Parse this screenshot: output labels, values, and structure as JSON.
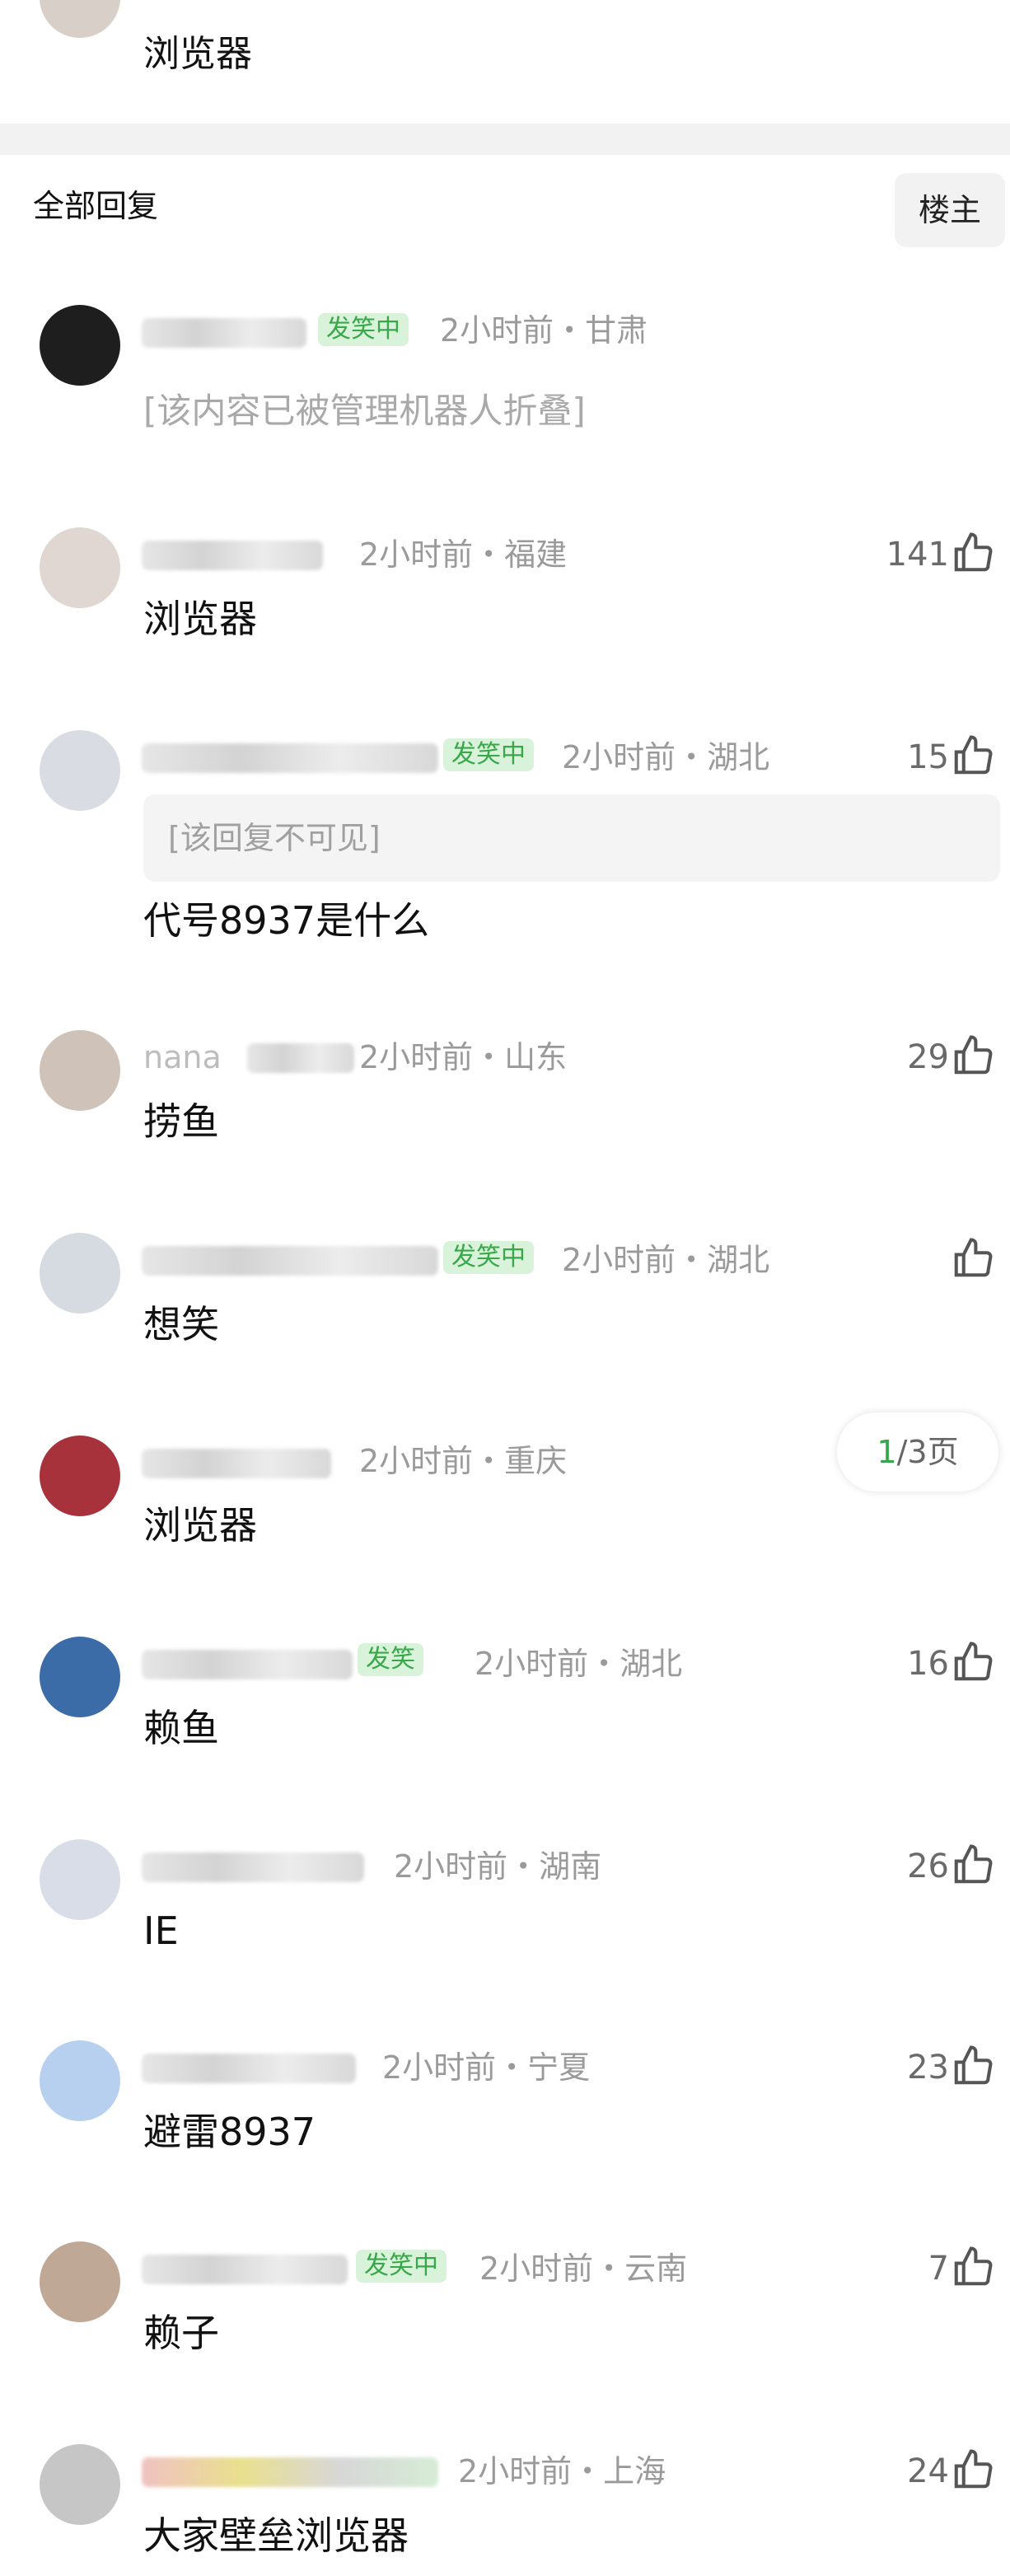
{
  "top_comment": {
    "text": "浏览器"
  },
  "reply_header": {
    "title": "全部回复",
    "sort_label": "楼主"
  },
  "colors": {
    "badge_bg": "#d9f2da",
    "badge_text": "#39a84a",
    "meta": "#9a9a9a"
  },
  "icons": {
    "like": "thumbs-up-icon"
  },
  "comments": [
    {
      "badge": "发笑中",
      "meta": "2小时前・甘肃",
      "likes": "",
      "text": "[该内容已被管理机器人折叠]"
    },
    {
      "badge": "",
      "meta": "2小时前・福建",
      "likes": "141",
      "text": "浏览器"
    },
    {
      "badge": "发笑中",
      "meta": "2小时前・湖北",
      "likes": "15",
      "quote": "[该回复不可见]",
      "text": "代号8937是什么"
    },
    {
      "name": "nana",
      "badge": "",
      "meta": "2小时前・山东",
      "likes": "29",
      "text": "捞鱼"
    },
    {
      "badge": "发笑中",
      "meta": "2小时前・湖北",
      "likes": "",
      "text": "想笑"
    },
    {
      "badge": "",
      "meta": "2小时前・重庆",
      "likes": "",
      "text": "浏览器",
      "page_current": "1",
      "page_rest": "/3页"
    },
    {
      "badge": "发笑",
      "meta": "2小时前・湖北",
      "likes": "16",
      "text": "赖鱼"
    },
    {
      "badge": "",
      "meta": "2小时前・湖南",
      "likes": "26",
      "text": "IE"
    },
    {
      "badge": "",
      "meta": "2小时前・宁夏",
      "likes": "23",
      "text": "避雷8937"
    },
    {
      "badge": "发笑中",
      "meta": "2小时前・云南",
      "likes": "7",
      "text": "赖子"
    },
    {
      "badge": "",
      "meta": "2小时前・上海",
      "likes": "24",
      "text": "大家壁垒浏览器"
    }
  ]
}
